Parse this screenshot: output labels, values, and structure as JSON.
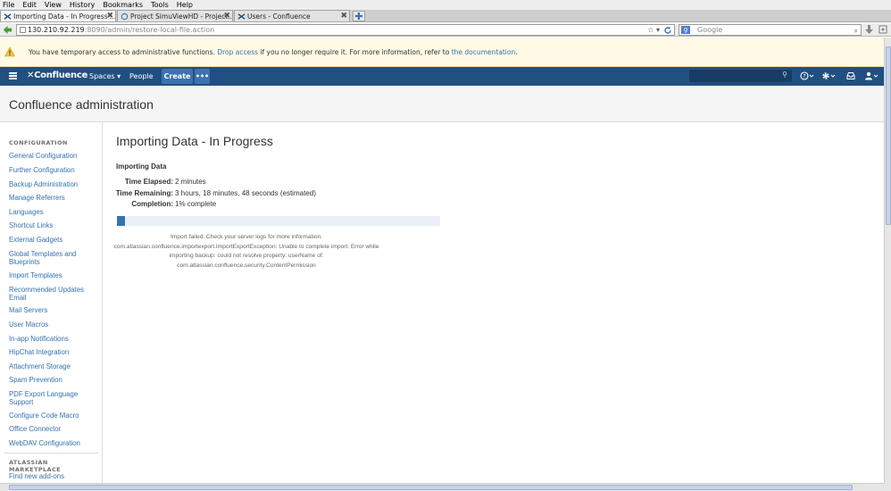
{
  "browser": {
    "menu": [
      "File",
      "Edit",
      "View",
      "History",
      "Bookmarks",
      "Tools",
      "Help"
    ],
    "tabs": [
      {
        "label": "Importing Data - In Progress ..."
      },
      {
        "label": "Project SimuViewHD - Project..."
      },
      {
        "label": "Users - Confluence"
      }
    ],
    "url_host": "130.210.92.219",
    "url_rest": ":8090/admin/restore-local-file.action",
    "search_placeholder": "Google"
  },
  "banner": {
    "text_before": "You have temporary access to administrative functions. ",
    "link1": "Drop access",
    "text_middle": " if you no longer require it. For more information, refer to ",
    "link2": "the documentation",
    "text_after": "."
  },
  "header": {
    "logo": "Confluence",
    "spaces": "Spaces ▾",
    "people": "People",
    "create": "Create",
    "more": "•••"
  },
  "page_title": "Confluence administration",
  "sidebar": {
    "config_heading": "CONFIGURATION",
    "items": [
      "General Configuration",
      "Further Configuration",
      "Backup Administration",
      "Manage Referrers",
      "Languages",
      "Shortcut Links",
      "External Gadgets",
      "Global Templates and Blueprints",
      "Import Templates",
      "Recommended Updates Email",
      "Mail Servers",
      "User Macros",
      "In-app Notifications",
      "HipChat Integration",
      "Attachment Storage",
      "Spam Prevention",
      "PDF Export Language Support",
      "Configure Code Macro",
      "Office Connector",
      "WebDAV Configuration"
    ],
    "marketplace_heading": "ATLASSIAN MARKETPLACE",
    "marketplace_items": [
      "Find new add-ons"
    ]
  },
  "main": {
    "title": "Importing Data - In Progress",
    "subtitle": "Importing Data",
    "stats": [
      {
        "label": "Time Elapsed:",
        "value": "2 minutes"
      },
      {
        "label": "Time Remaining:",
        "value": "3 hours, 18 minutes, 48 seconds (estimated)"
      },
      {
        "label": "Completion:",
        "value": "1% complete"
      }
    ],
    "progress_percent": 1,
    "error_lines": [
      "Import failed. Check your server logs for more information.",
      "com.atlassian.confluence.importexport.ImportExportException: Unable to complete import: Error while",
      "importing backup: could not resolve property: userName of:",
      "com.atlassian.confluence.security.ContentPermission"
    ]
  },
  "colors": {
    "header_bg": "#205081",
    "link": "#3572b0",
    "banner_bg": "#fffae6"
  }
}
